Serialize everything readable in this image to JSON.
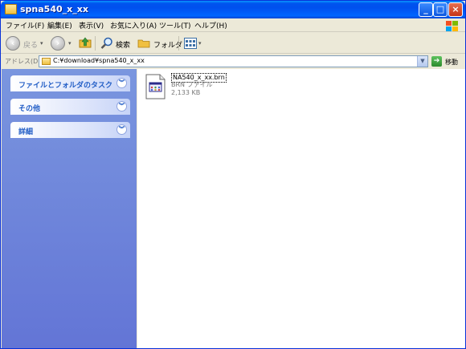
{
  "window": {
    "title": "spna540_x_xx"
  },
  "menu": [
    "ファイル(F)",
    "編集(E)",
    "表示(V)",
    "お気に入り(A)",
    "ツール(T)",
    "ヘルプ(H)"
  ],
  "toolbar": {
    "back_label": "戻る",
    "search_label": "検索",
    "folders_label": "フォルダ"
  },
  "address": {
    "label": "アドレス(D)",
    "value": "C:¥download¥spna540_x_xx",
    "go_label": "移動"
  },
  "tasks": [
    {
      "label": "ファイルとフォルダのタスク"
    },
    {
      "label": "その他"
    },
    {
      "label": "詳細"
    }
  ],
  "files": [
    {
      "name": "NA540_x_xx.brn",
      "type": "BRN ファイル",
      "size": "2,133 KB"
    }
  ],
  "colors": {
    "titlebar": "#0053ee",
    "task_pane": "#7a96df",
    "task_text": "#215dc6"
  },
  "icons": [
    "window-folder-icon",
    "minimize-icon",
    "maximize-icon",
    "close-icon",
    "windows-logo-icon",
    "back-icon",
    "forward-icon",
    "up-folder-icon",
    "search-icon",
    "folders-icon",
    "views-icon",
    "chevron-down-icon",
    "go-arrow-icon",
    "brn-file-icon"
  ]
}
